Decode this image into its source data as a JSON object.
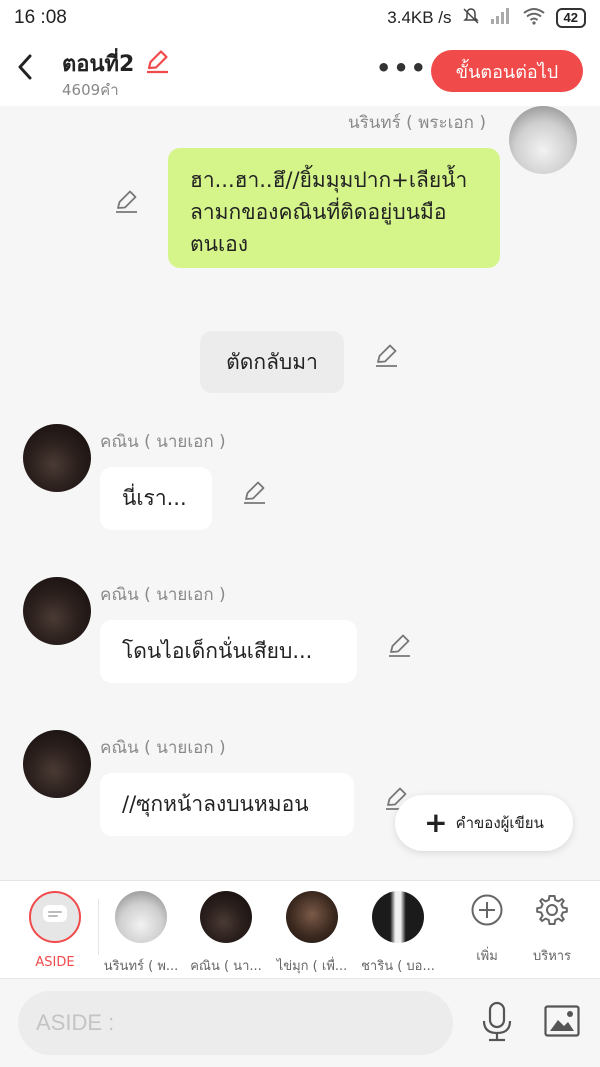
{
  "status": {
    "time": "16 :08",
    "net": "3.4KB /s",
    "battery": "42"
  },
  "header": {
    "title": "ตอนที่2",
    "wordcount": "4609คำ",
    "more": "•••",
    "next": "ขั้นตอนต่อไป"
  },
  "messages": [
    {
      "name": "นรินทร์ ( พระเอก )",
      "text": "ฮา...ฮา..ฮึ//ยิ้มมุมปาก+เลียน้ำลามกของคณินที่ติดอยู่บนมือตนเอง"
    },
    {
      "text": "ตัดกลับมา"
    },
    {
      "name": "คณิน ( นายเอก )",
      "text": "นี่เรา..."
    },
    {
      "name": "คณิน ( นายเอก )",
      "text": "โดนไอเด็กนั่นเสียบ..."
    },
    {
      "name": "คณิน ( นายเอก )",
      "text": "//ซุกหน้าลงบนหมอน"
    }
  ],
  "fab": {
    "label": "คำของผู้เขียน"
  },
  "characters": [
    {
      "label": "ASIDE"
    },
    {
      "label": "นรินทร์ ( พ..."
    },
    {
      "label": "คณิน ( นา..."
    },
    {
      "label": "ไข่มุก ( เพื่..."
    },
    {
      "label": "ชาริน ( บอ..."
    }
  ],
  "tools": {
    "add": "เพิ่ม",
    "manage": "บริหาร"
  },
  "input": {
    "placeholder": "ASIDE :"
  },
  "colors": {
    "accent": "#f04a4a",
    "green_bubble": "#d5f58a"
  }
}
